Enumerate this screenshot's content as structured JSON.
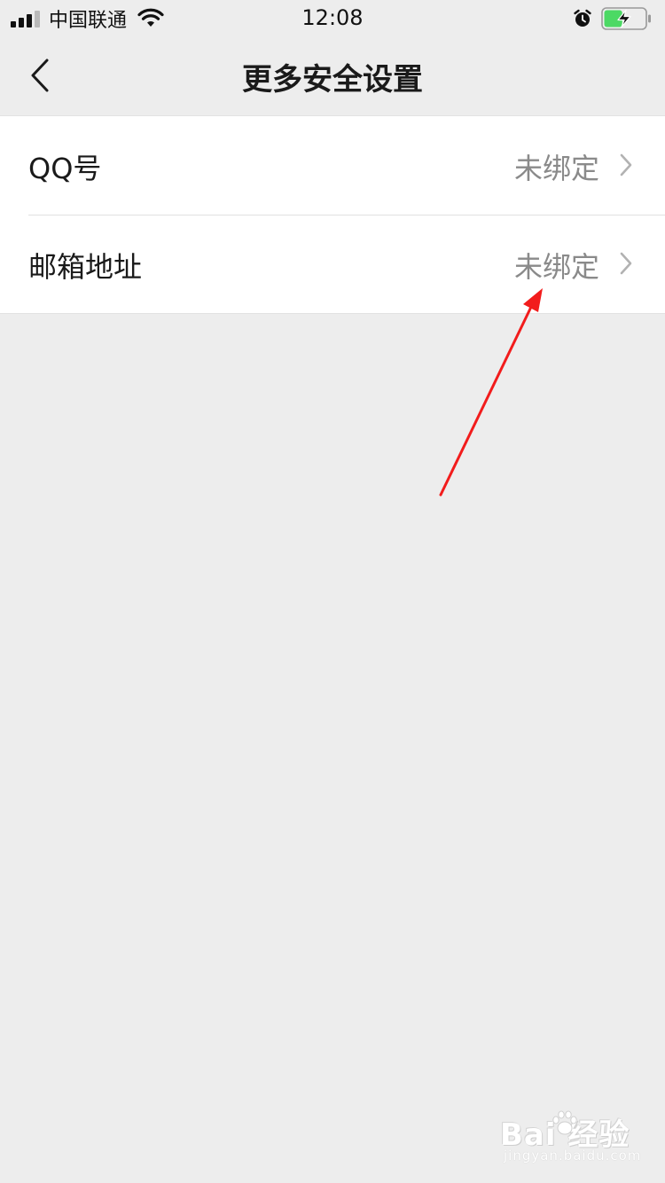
{
  "status_bar": {
    "carrier": "中国联通",
    "time": "12:08",
    "signal_bars": 3,
    "signal_bars_total": 4,
    "battery_level": 0.45,
    "battery_color": "#4cd964",
    "icons": [
      "signal-icon",
      "wifi-icon",
      "alarm-icon",
      "battery-charging-icon"
    ]
  },
  "nav": {
    "title": "更多安全设置",
    "back_icon": "chevron-left-icon"
  },
  "settings": {
    "items": [
      {
        "label": "QQ号",
        "value": "未绑定"
      },
      {
        "label": "邮箱地址",
        "value": "未绑定"
      }
    ]
  },
  "annotation": {
    "arrow_color": "#f21c1c"
  },
  "watermark": {
    "brand": "Bai  经验",
    "url": "jingyan.baidu.com"
  },
  "colors": {
    "background": "#ededed",
    "list_background": "#ffffff",
    "value_text": "#8a8a8a"
  }
}
